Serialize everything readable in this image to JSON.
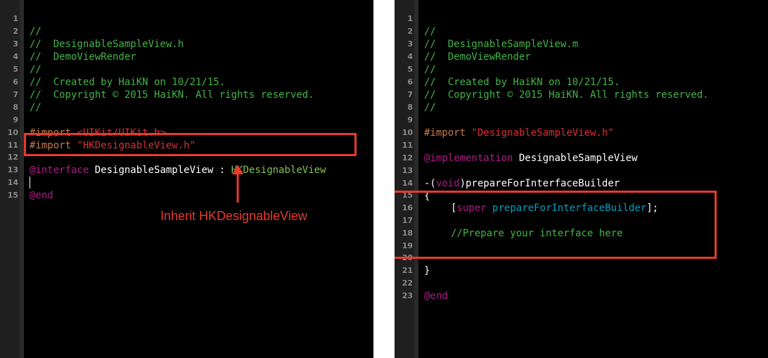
{
  "left_pane": {
    "line_numbers": [
      "1",
      "2",
      "3",
      "4",
      "5",
      "6",
      "7",
      "8",
      "9",
      "10",
      "11",
      "12",
      "13",
      "14",
      "15"
    ],
    "code": {
      "l1": "//",
      "l2": "//  DesignableSampleView.h",
      "l3": "//  DemoViewRender",
      "l4": "//",
      "l5": "//  Created by HaiKN on 10/21/15.",
      "l6": "//  Copyright © 2015 HaiKN. All rights reserved.",
      "l7": "//",
      "l9_directive": "#import",
      "l9_path": "<UIKit/UIKit.h>",
      "l10_directive": "#import",
      "l10_path": "\"HKDesignableView.h\"",
      "l12_keyword": "@interface",
      "l12_class": "DesignableSampleView",
      "l12_colon": ":",
      "l12_super": "HKDesignableView",
      "l14_keyword": "@end"
    },
    "annotation": "Inherit HKDesignableView"
  },
  "right_pane": {
    "line_numbers": [
      "1",
      "2",
      "3",
      "4",
      "5",
      "6",
      "7",
      "8",
      "9",
      "10",
      "11",
      "12",
      "13",
      "14",
      "15",
      "16",
      "17",
      "18",
      "19",
      "20",
      "21",
      "22",
      "23"
    ],
    "code": {
      "l1": "//",
      "l2": "//  DesignableSampleView.m",
      "l3": "//  DemoViewRender",
      "l4": "//",
      "l5": "//  Created by HaiKN on 10/21/15.",
      "l6": "//  Copyright © 2015 HaiKN. All rights reserved.",
      "l7": "//",
      "l9_directive": "#import",
      "l9_path": "\"DesignableSampleView.h\"",
      "l11_keyword": "@implementation",
      "l11_class": "DesignableSampleView",
      "l13_prefix": "-(",
      "l13_type": "void",
      "l13_method": ")prepareForInterfaceBuilder",
      "l14": "{",
      "l15_open": "[",
      "l15_super": "super",
      "l15_method": "prepareForInterfaceBuilder",
      "l15_close": "];",
      "l17_comment": "//Prepare your interface here",
      "l20": "}",
      "l22_keyword": "@end"
    }
  },
  "colors": {
    "comment": "#41b645",
    "directive": "#c67c48",
    "string": "#db2c38",
    "keyword": "#b21889",
    "class_ref": "#83c057",
    "method_ref": "#00a0be",
    "highlight": "#e8392f"
  }
}
